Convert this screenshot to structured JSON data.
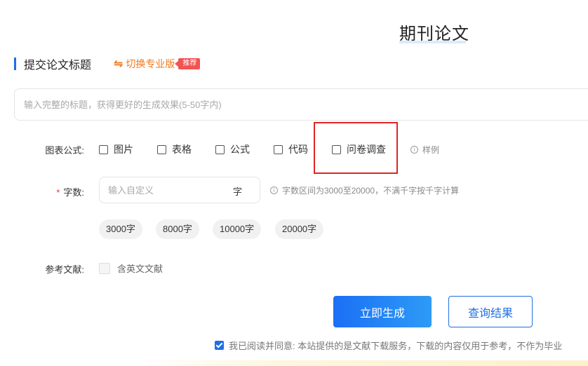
{
  "page": {
    "title": "期刊论文"
  },
  "section": {
    "title": "提交论文标题",
    "switch_icon": "⇋",
    "switch_label": "切换专业版",
    "badge": "推荐"
  },
  "title_input": {
    "placeholder": "输入完整的标题，获得更好的生成效果(5-50字内)"
  },
  "charts": {
    "label": "图表公式:",
    "options": [
      "图片",
      "表格",
      "公式",
      "代码",
      "问卷调查"
    ],
    "sample_icon": "i",
    "sample_label": "样例"
  },
  "wordcount": {
    "star": "*",
    "label": "字数:",
    "placeholder": "输入自定义",
    "unit": "字",
    "hint_icon": "i",
    "hint": "字数区间为3000至20000，不满千字按千字计算",
    "presets": [
      "3000字",
      "8000字",
      "10000字",
      "20000字"
    ]
  },
  "references": {
    "label": "参考文献:",
    "option": "含英文文献"
  },
  "actions": {
    "generate": "立即生成",
    "query": "查询结果"
  },
  "agreement": {
    "text": "我已阅读并同意: 本站提供的是文献下载服务，下载的内容仅用于参考，不作为毕业"
  },
  "colors": {
    "accent": "#1f6fe6",
    "highlight": "#e02424",
    "badge": "#f25353",
    "link": "#f0781e"
  }
}
